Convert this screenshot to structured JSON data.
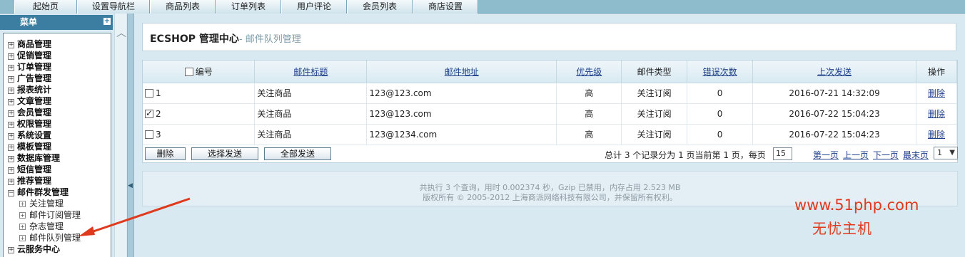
{
  "top_tabs": [
    "起始页",
    "设置导航栏",
    "商品列表",
    "订单列表",
    "用户评论",
    "会员列表",
    "商店设置"
  ],
  "menu": {
    "title": "菜单",
    "toggle": "+",
    "items": [
      "商品管理",
      "促销管理",
      "订单管理",
      "广告管理",
      "报表统计",
      "文章管理",
      "会员管理",
      "权限管理",
      "系统设置",
      "模板管理",
      "数据库管理",
      "短信管理",
      "推荐管理"
    ],
    "expanded": {
      "label": "邮件群发管理",
      "children": [
        "关注管理",
        "邮件订阅管理",
        "杂志管理",
        "邮件队列管理"
      ]
    },
    "last_item": "云服务中心",
    "expand_symbol": "+",
    "collapse_symbol": "−"
  },
  "page": {
    "title": "ECSHOP 管理中心",
    "subtitle": "- 邮件队列管理"
  },
  "table": {
    "columns": [
      "编号",
      "邮件标题",
      "邮件地址",
      "优先级",
      "邮件类型",
      "错误次数",
      "上次发送",
      "操作"
    ],
    "rows": [
      {
        "id": "1",
        "checked": false,
        "title": "关注商品",
        "email": "123@123.com",
        "priority": "高",
        "type": "关注订阅",
        "errors": "0",
        "last_sent": "2016-07-21 14:32:09",
        "action": "删除"
      },
      {
        "id": "2",
        "checked": true,
        "title": "关注商品",
        "email": "123@123.com",
        "priority": "高",
        "type": "关注订阅",
        "errors": "0",
        "last_sent": "2016-07-22 15:04:23",
        "action": "删除"
      },
      {
        "id": "3",
        "checked": false,
        "title": "关注商品",
        "email": "123@1234.com",
        "priority": "高",
        "type": "关注订阅",
        "errors": "0",
        "last_sent": "2016-07-22 15:04:23",
        "action": "删除"
      }
    ]
  },
  "buttons": {
    "delete": "删除",
    "send_selected": "选择发送",
    "send_all": "全部发送"
  },
  "pager": {
    "summary": "总计 3 个记录分为 1 页当前第 1 页，每页",
    "page_size": "15",
    "first": "第一页",
    "prev": "上一页",
    "next": "下一页",
    "last": "最末页",
    "page_select": "1"
  },
  "footer": {
    "line1": "共执行 3 个查询，用时 0.002374 秒，Gzip 已禁用，内存占用 2.523 MB",
    "line2": "版权所有 © 2005-2012 上海商派网络科技有限公司，并保留所有权利。"
  },
  "watermark": {
    "line1": "www.51php.com",
    "line2": "无忧主机",
    "color": "#e03a1e"
  }
}
